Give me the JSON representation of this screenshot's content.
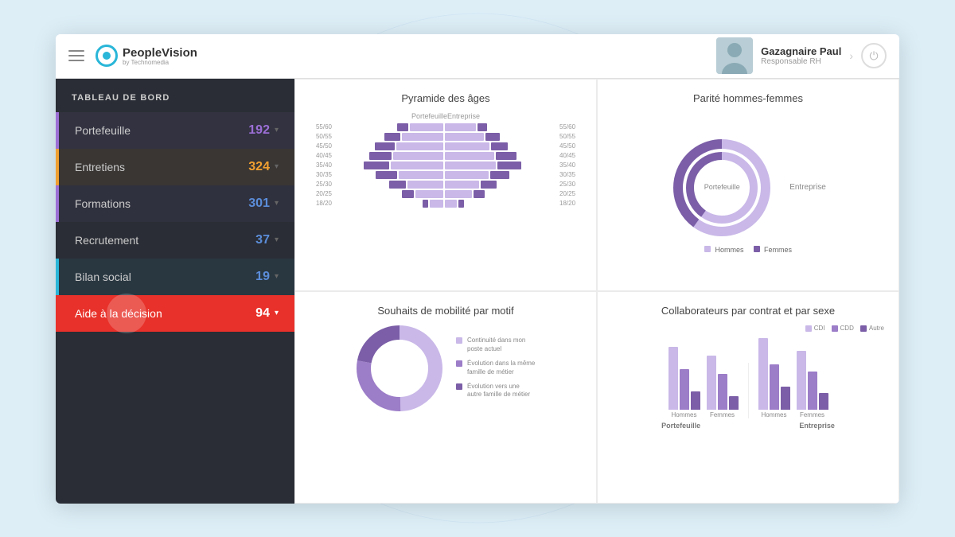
{
  "app": {
    "title": "PeopleVision",
    "subtitle": "by Technomedia"
  },
  "header": {
    "user_name": "Gazagnaire Paul",
    "user_role": "Responsable RH"
  },
  "sidebar": {
    "section_title": "TABLEAU DE BORD",
    "items": [
      {
        "id": "portefeuille",
        "label": "Portefeuille",
        "count": "192",
        "accent": "#9c6fd6"
      },
      {
        "id": "entretiens",
        "label": "Entretiens",
        "count": "324",
        "accent": "#f0a030"
      },
      {
        "id": "formations",
        "label": "Formations",
        "count": "301",
        "accent": "#5b8dd9"
      },
      {
        "id": "recrutement",
        "label": "Recrutement",
        "count": "37",
        "accent": "#5b8dd9"
      },
      {
        "id": "bilan",
        "label": "Bilan social",
        "count": "19",
        "accent": "#5b8dd9"
      },
      {
        "id": "aide",
        "label": "Aide à la décision",
        "count": "94",
        "accent": "#ffffff"
      }
    ]
  },
  "charts": {
    "pyramide": {
      "title": "Pyramide des âges",
      "col_left": "Portefeuille",
      "col_right": "Entreprise",
      "rows": [
        {
          "label": "55/60",
          "left_light": 60,
          "left_dark": 20,
          "right_light": 55,
          "right_dark": 18
        },
        {
          "label": "50/55",
          "left_light": 75,
          "left_dark": 28,
          "right_light": 70,
          "right_dark": 25
        },
        {
          "label": "45/50",
          "left_light": 85,
          "left_dark": 35,
          "right_light": 80,
          "right_dark": 30
        },
        {
          "label": "40/45",
          "left_light": 90,
          "left_dark": 40,
          "right_light": 88,
          "right_dark": 38
        },
        {
          "label": "35/40",
          "left_light": 95,
          "left_dark": 45,
          "right_light": 92,
          "right_dark": 42
        },
        {
          "label": "30/35",
          "left_light": 80,
          "left_dark": 38,
          "right_light": 78,
          "right_dark": 35
        },
        {
          "label": "25/30",
          "left_light": 65,
          "left_dark": 30,
          "right_light": 62,
          "right_dark": 28
        },
        {
          "label": "20/25",
          "left_light": 50,
          "left_dark": 22,
          "right_light": 48,
          "right_dark": 20
        },
        {
          "label": "18/20",
          "left_light": 25,
          "left_dark": 10,
          "right_light": 22,
          "right_dark": 9
        }
      ]
    },
    "parite": {
      "title": "Parité hommes-femmes",
      "center_label": "Portefeuille",
      "right_label": "Entreprise",
      "legend_hommes": "Hommes",
      "legend_femmes": "Femmes"
    },
    "mobilite": {
      "title": "Souhaits de mobilité par motif",
      "legend": [
        {
          "label": "Continuité dans mon poste actuel",
          "color": "light"
        },
        {
          "label": "Évolution dans la même famille de métier",
          "color": "mid"
        },
        {
          "label": "Évolution vers une autre famille de métier",
          "color": "dark"
        }
      ]
    },
    "collaborateurs": {
      "title": "Collaborateurs par contrat et par sexe",
      "groups": [
        {
          "label": "Hommes",
          "section": "Portefeuille",
          "cdi": 70,
          "cdd": 45,
          "autre": 20
        },
        {
          "label": "Femmes",
          "section": "Portefeuille",
          "cdi": 60,
          "cdd": 40,
          "autre": 15
        },
        {
          "label": "Hommes",
          "section": "Entreprise",
          "cdi": 80,
          "cdd": 50,
          "autre": 25
        },
        {
          "label": "Femmes",
          "section": "Entreprise",
          "cdi": 65,
          "cdd": 42,
          "autre": 18
        }
      ],
      "legend": [
        "CDI",
        "CDD",
        "Autre"
      ],
      "sections": [
        "Portefeuille",
        "Entreprise"
      ]
    }
  }
}
